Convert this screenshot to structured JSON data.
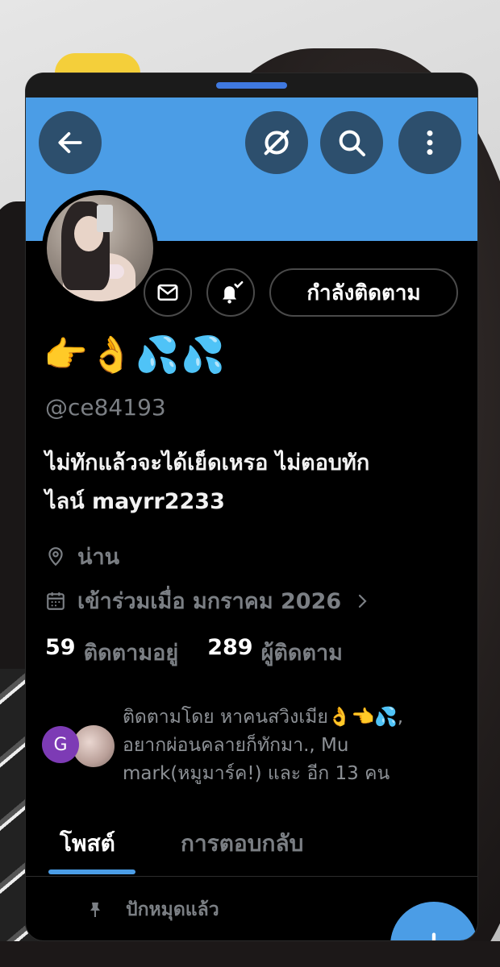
{
  "profile": {
    "display_name": "👉👌💦💦",
    "handle": "@ce84193",
    "bio_line1": "ไม่ทักแล้วจะได้เย็ดเหรอ ไม่ตอบทัก",
    "bio_line2": "ไลน์ mayrr2233",
    "location": "น่าน",
    "joined": "เข้าร่วมเมื่อ มกราคม 2026",
    "following_count": "59",
    "following_label": "ติดตามอยู่",
    "followers_count": "289",
    "followers_label": "ผู้ติดตาม"
  },
  "header": {
    "follow_button_label": "กำลังติดตาม"
  },
  "followed_by": {
    "avatar_letter": "G",
    "text_line1": "ติดตามโดย หาคนสวิงเมีย👌👈💦,",
    "text_line2": "อยากผ่อนคลายก็ทักมา., Mu",
    "text_line3": "mark(หมูมาร์ค!) และ อีก 13 คน"
  },
  "tabs": {
    "posts": "โพสต์",
    "replies": "การตอบกลับ"
  },
  "pinned_label": "ปักหมุดแล้ว",
  "colors": {
    "accent": "#4b9de6",
    "banner": "#4b9de6",
    "background": "#000000",
    "muted_text": "#7b7f84"
  },
  "icons": [
    "back-arrow-icon",
    "no-view-icon",
    "search-icon",
    "more-vertical-icon",
    "mail-icon",
    "bell-check-icon",
    "location-icon",
    "calendar-icon",
    "chevron-right-icon",
    "pin-icon",
    "plus-icon"
  ]
}
